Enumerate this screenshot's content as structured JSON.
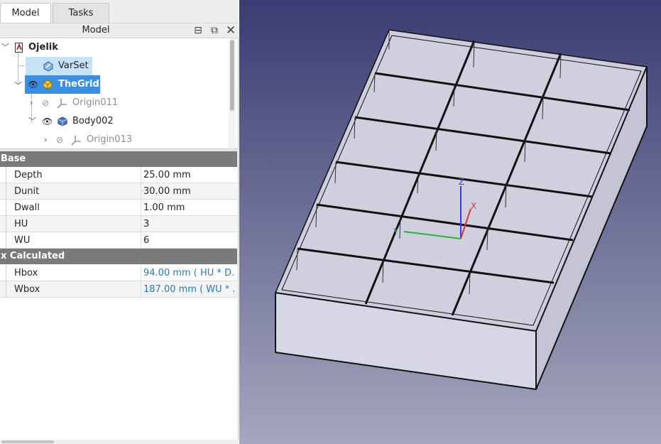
{
  "tabs": {
    "model": "Model",
    "tasks": "Tasks"
  },
  "panel": {
    "title": "Model"
  },
  "tree": {
    "root": "Ojelik",
    "varset": "VarSet",
    "thegrid": "TheGrid",
    "origin011": "Origin011",
    "body002": "Body002",
    "origin013": "Origin013"
  },
  "properties": {
    "group_base": "Base",
    "base": [
      {
        "name": "Depth",
        "value": "25.00 mm"
      },
      {
        "name": "Dunit",
        "value": "30.00 mm"
      },
      {
        "name": "Dwall",
        "value": "1.00 mm"
      },
      {
        "name": "HU",
        "value": "3"
      },
      {
        "name": "WU",
        "value": "6"
      }
    ],
    "group_calc": "x Calculated",
    "calc": [
      {
        "name": "Hbox",
        "value": "94.00 mm  ( HU * D..."
      },
      {
        "name": "Wbox",
        "value": "187.00 mm  ( WU * ..."
      }
    ]
  },
  "axes": {
    "x": "X",
    "y": "Y",
    "z": "Z"
  },
  "colors": {
    "accent": "#3d8fe4",
    "varset_highlight": "#c7e1f5",
    "view_top": "#3a3c73",
    "view_bottom": "#a4a7bd",
    "model_face": "#d6d6e6",
    "axis_x": "#d93636",
    "axis_y": "#2fb52f",
    "axis_z": "#3b3be0"
  },
  "icons": [
    "document-icon",
    "varset-icon",
    "part-icon",
    "body-icon",
    "origin-icon",
    "eye-icon",
    "eye-hidden-icon"
  ]
}
